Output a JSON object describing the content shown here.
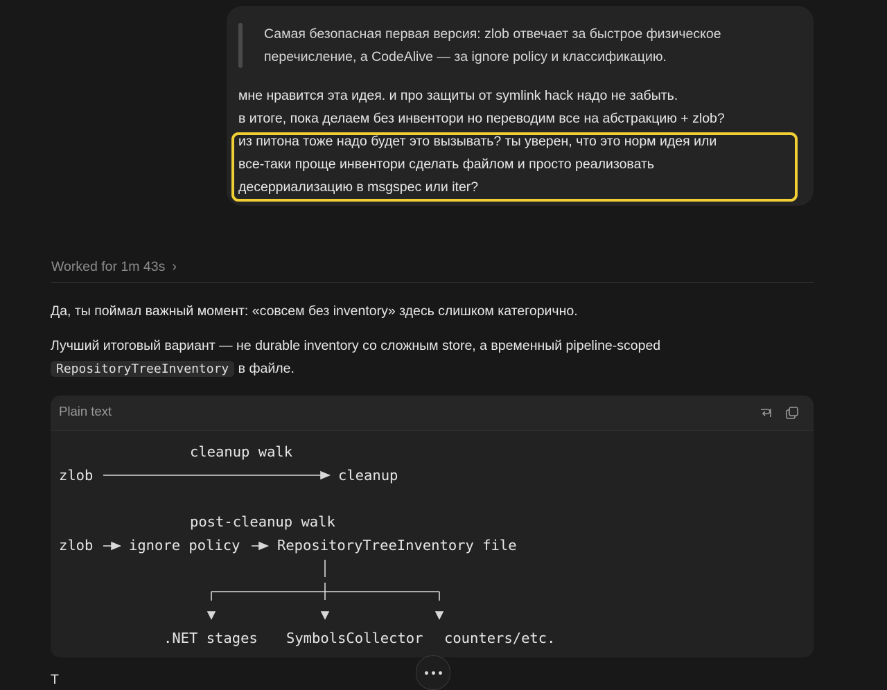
{
  "user_message": {
    "quote": "Самая безопасная первая версия: zlob отвечает за быстрое физическое перечисление, а CodeAlive — за ignore policy и классификацию.",
    "lines": [
      "мне нравится эта идея. и про защиты от symlink hack надо не забыть.",
      "в итоге, пока делаем без инвентори но переводим все на абстракцию + zlob?",
      "из питона тоже надо будет это вызывать? ты уверен, что это норм идея или",
      "все-таки проще инвентори сделать файлом и просто реализовать",
      "десерриализацию в msgspec или iter?"
    ],
    "highlight_color": "#f1cf34"
  },
  "worked_for": {
    "label": "Worked for 1m 43s",
    "icon": "chevron-right-icon"
  },
  "assistant_message": {
    "paragraph1": "Да, ты поймал важный момент: «совсем без inventory» здесь слишком категорично.",
    "paragraph2_line1": "Лучший итоговый вариант — не durable inventory со сложным store, а временный pipeline-scoped",
    "paragraph2_code": "RepositoryTreeInventory",
    "paragraph2_tail": " в файле.",
    "code_block": {
      "language": "Plain text",
      "icons": [
        "wrap-lines-icon",
        "copy-icon"
      ],
      "row1_label": "cleanup walk",
      "row1_left": "zlob",
      "row1_right": "cleanup",
      "row2_label": "post-cleanup walk",
      "row2_left": "zlob",
      "row2_mid": "ignore policy",
      "row2_right": "RepositoryTreeInventory file",
      "targets": [
        ".NET stages",
        "SymbolsCollector",
        "counters/etc."
      ]
    },
    "cut_text": "Т"
  },
  "more_button": {
    "icon": "ellipsis-icon"
  }
}
